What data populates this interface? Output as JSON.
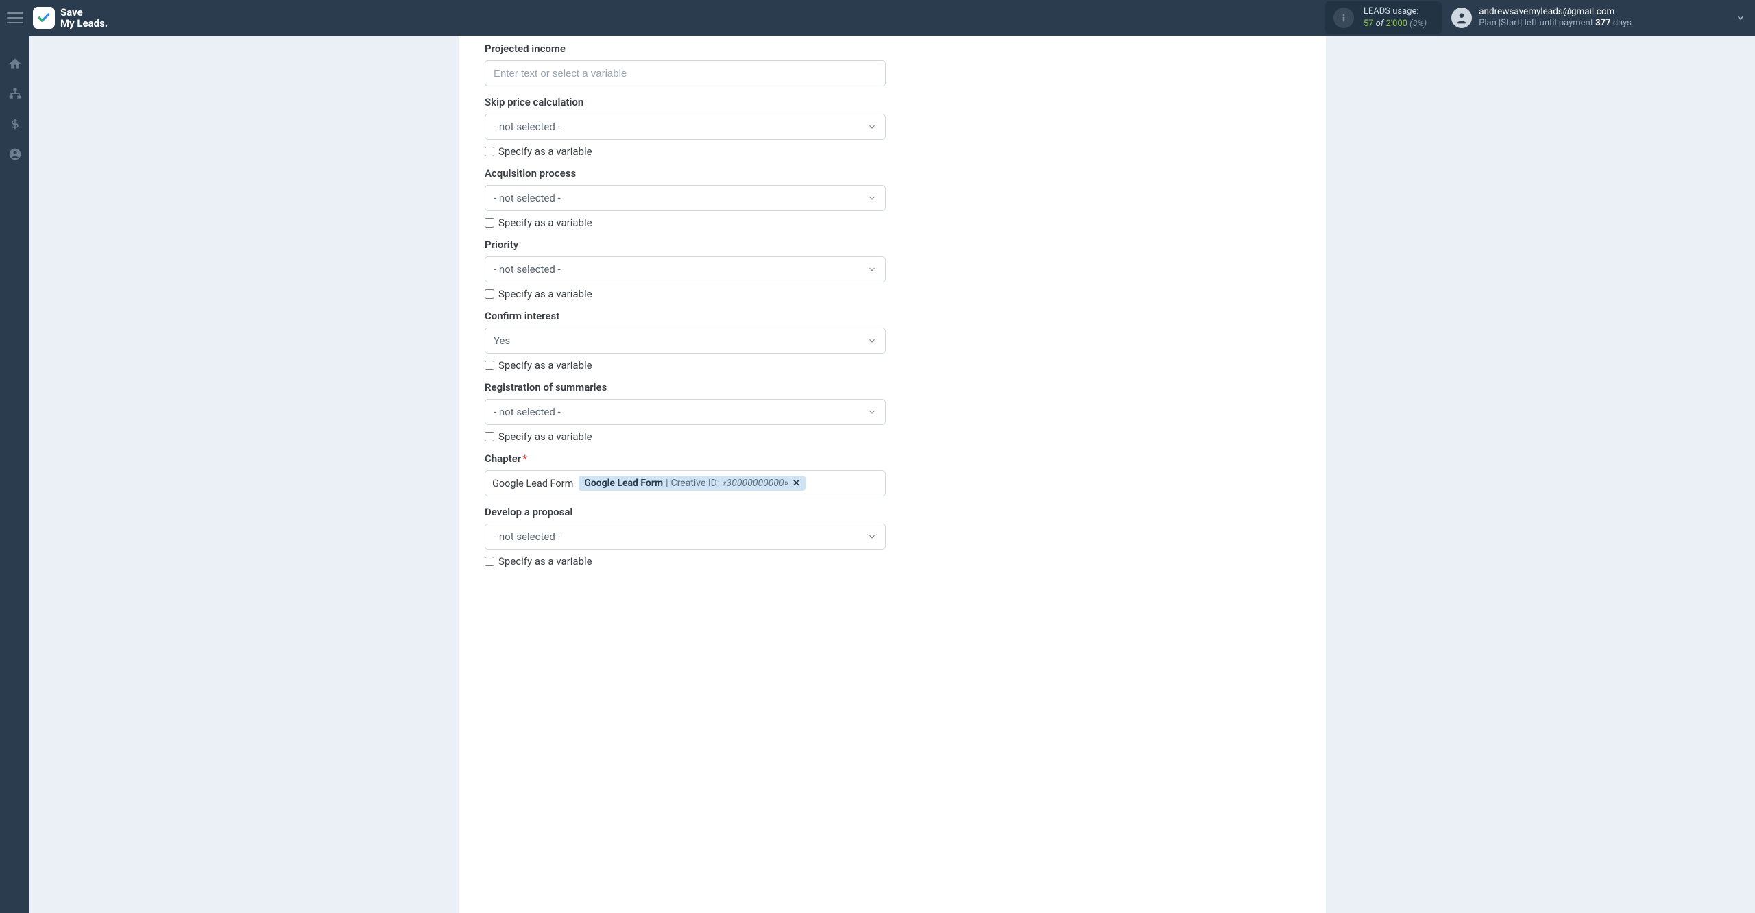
{
  "header": {
    "logo_line1": "Save",
    "logo_line2": "My Leads.",
    "usage": {
      "label": "LEADS usage:",
      "count": "57",
      "of": " of ",
      "total": "2'000",
      "pct": " (3%)"
    },
    "account": {
      "email": "andrewsavemyleads@gmail.com",
      "plan_prefix": "Plan |Start| left until payment ",
      "days": "377",
      "plan_suffix": " days"
    }
  },
  "fields": {
    "projected_income": {
      "label": "Projected income",
      "placeholder": "Enter text or select a variable"
    },
    "skip_price": {
      "label": "Skip price calculation",
      "value": "- not selected -",
      "checkbox": "Specify as a variable"
    },
    "acquisition": {
      "label": "Acquisition process",
      "value": "- not selected -",
      "checkbox": "Specify as a variable"
    },
    "priority": {
      "label": "Priority",
      "value": "- not selected -",
      "checkbox": "Specify as a variable"
    },
    "confirm_interest": {
      "label": "Confirm interest",
      "value": "Yes",
      "checkbox": "Specify as a variable"
    },
    "registration": {
      "label": "Registration of summaries",
      "value": "- not selected -",
      "checkbox": "Specify as a variable"
    },
    "chapter": {
      "label": "Chapter",
      "prefix": "Google Lead Form",
      "tag_strong": "Google Lead Form",
      "tag_sep": " | ",
      "tag_creative": "Creative ID: ",
      "tag_id": "«30000000000»"
    },
    "develop_proposal": {
      "label": "Develop a proposal",
      "value": "- not selected -",
      "checkbox": "Specify as a variable"
    }
  }
}
